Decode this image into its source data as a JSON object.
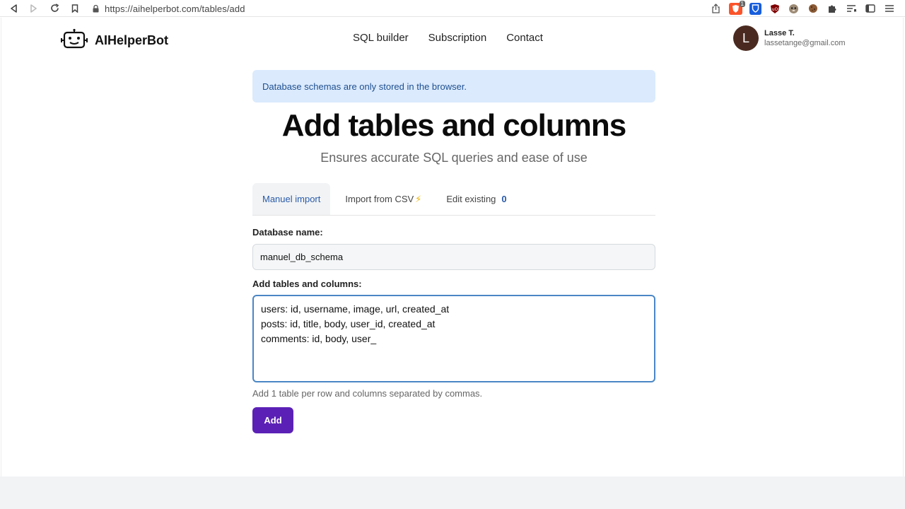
{
  "browser": {
    "url": "https://aihelperbot.com/tables/add",
    "brave_badge": "1"
  },
  "header": {
    "logo_text": "AIHelperBot",
    "nav": [
      "SQL builder",
      "Subscription",
      "Contact"
    ],
    "user": {
      "initial": "L",
      "name": "Lasse T.",
      "email": "lassetange@gmail.com"
    }
  },
  "alert": {
    "text": "Database schemas are only stored in the browser."
  },
  "title": "Add tables and columns",
  "subtitle": "Ensures accurate SQL queries and ease of use",
  "tabs": [
    {
      "label": "Manuel import",
      "active": true
    },
    {
      "label": "Import from CSV",
      "icon": "lightning-icon",
      "bolt": "⚡"
    },
    {
      "label": "Edit existing",
      "count": "0"
    }
  ],
  "form": {
    "db_label": "Database name:",
    "db_value": "manuel_db_schema",
    "tables_label": "Add tables and columns:",
    "tables_value": "users: id, username, image, url, created_at\nposts: id, title, body, user_id, created_at\ncomments: id, body, user_",
    "hint": "Add 1 table per row and columns separated by commas.",
    "add_label": "Add"
  },
  "colors": {
    "accent_purple": "#5b21b6",
    "alert_bg": "#dbeafd",
    "alert_text": "#1e4f8f",
    "tab_active": "#2a5aa8"
  }
}
